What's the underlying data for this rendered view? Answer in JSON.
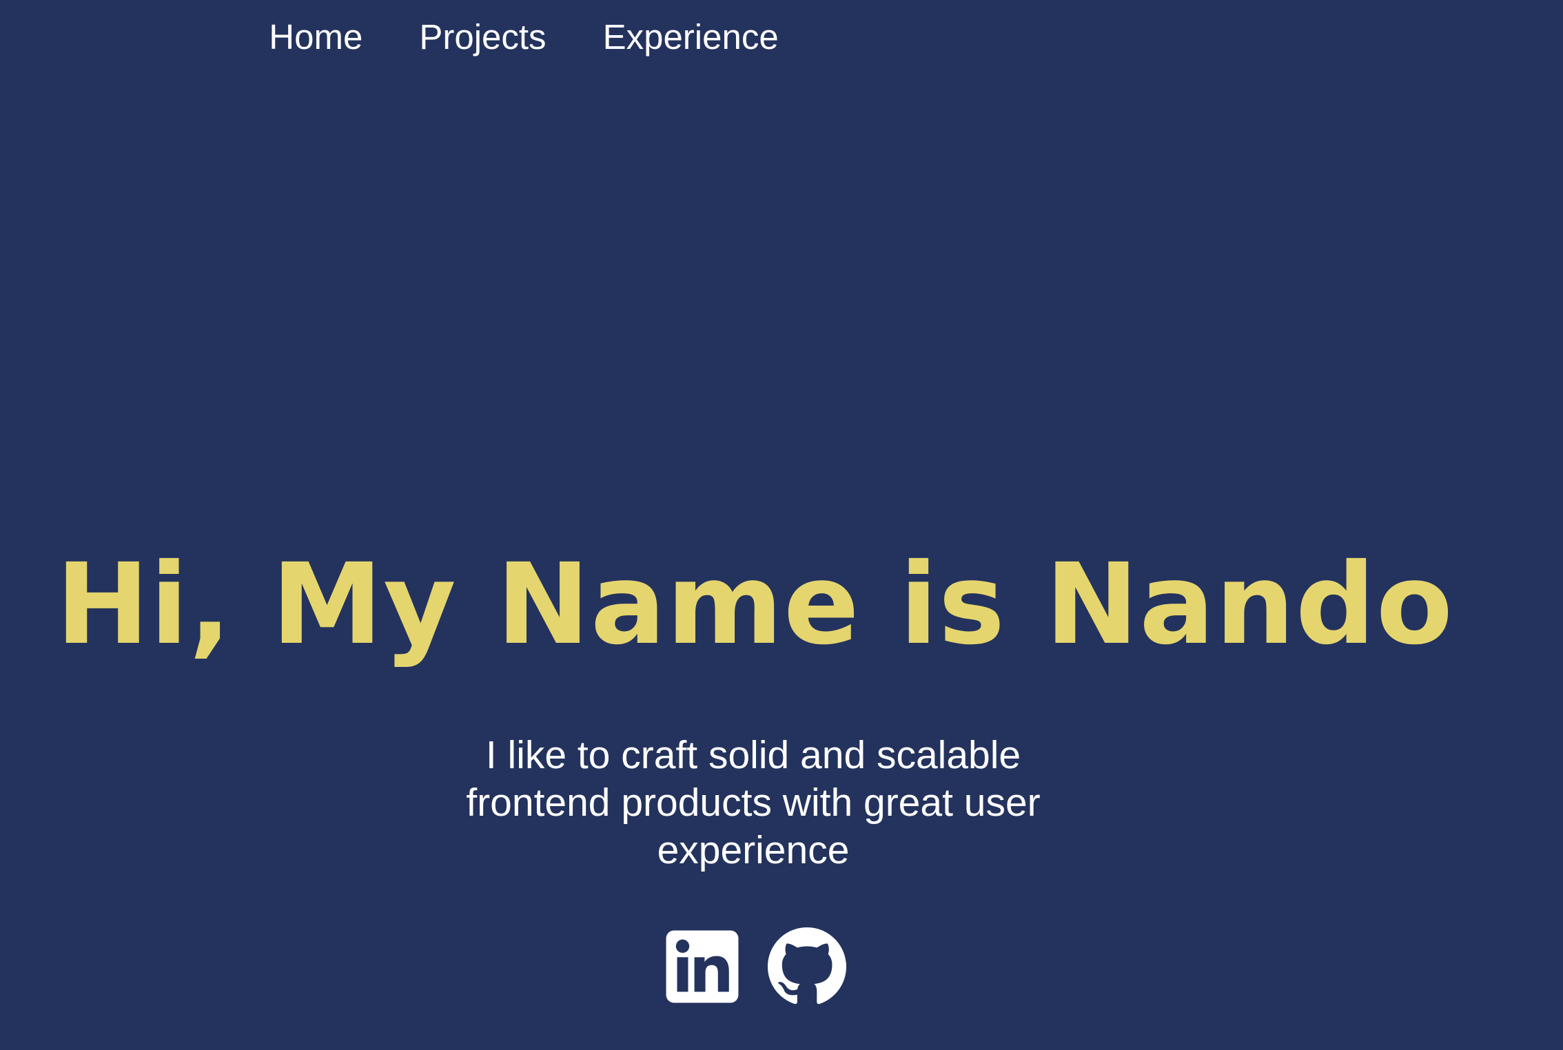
{
  "nav": {
    "items": [
      {
        "label": "Home"
      },
      {
        "label": "Projects"
      },
      {
        "label": "Experience"
      }
    ]
  },
  "hero": {
    "title": "Hi, My Name is Nando",
    "subtitle": "I like to craft solid and scalable frontend products with great user experience"
  },
  "social": {
    "icons": [
      "linkedin-icon",
      "github-icon"
    ]
  },
  "colors": {
    "background": "#24335d",
    "accent": "#e5d56e",
    "text": "#ffffff"
  }
}
